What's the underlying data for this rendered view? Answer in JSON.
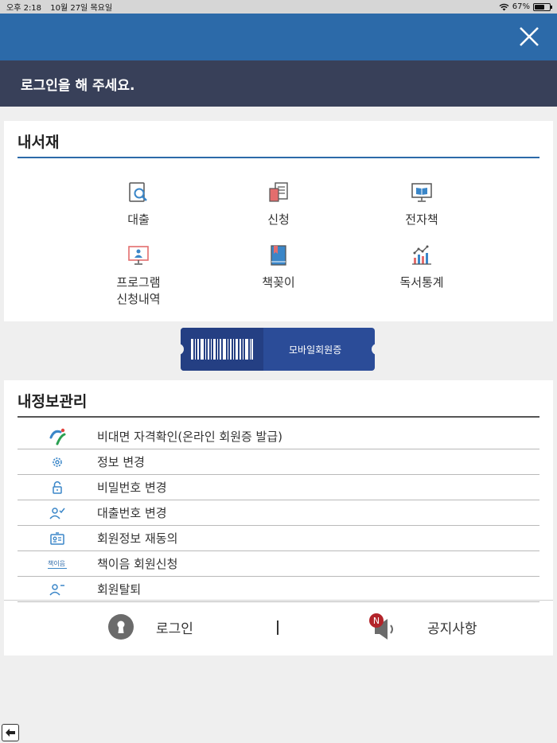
{
  "status_bar": {
    "time": "오후 2:18",
    "date": "10월 27일 목요일",
    "battery": "67%"
  },
  "header": {
    "login_prompt": "로그인을 해 주세요."
  },
  "my_library": {
    "title": "내서재",
    "items": [
      {
        "label": "대출",
        "icon": "book-search-icon"
      },
      {
        "label": "신청",
        "icon": "book-request-icon"
      },
      {
        "label": "전자책",
        "icon": "ebook-monitor-icon"
      },
      {
        "label_line1": "프로그램",
        "label_line2": "신청내역",
        "icon": "program-monitor-icon"
      },
      {
        "label": "책꽂이",
        "icon": "bookshelf-icon"
      },
      {
        "label": "독서통계",
        "icon": "reading-stats-icon"
      }
    ]
  },
  "mobile_card": {
    "label": "모바일회원증"
  },
  "my_info": {
    "title": "내정보관리",
    "items": [
      {
        "label": "비대면 자격확인(온라인 회원증 발급)",
        "icon": "verification-logo-icon"
      },
      {
        "label": "정보 변경",
        "icon": "gear-icon"
      },
      {
        "label": "비밀번호 변경",
        "icon": "unlock-icon"
      },
      {
        "label": "대출번호 변경",
        "icon": "user-check-icon"
      },
      {
        "label": "회원정보 재동의",
        "icon": "id-card-icon"
      },
      {
        "label": "책이음 회원신청",
        "icon": "chaekieum-logo-icon"
      },
      {
        "label": "회원탈퇴",
        "icon": "user-minus-icon"
      }
    ],
    "chaekieum_logo_text": "책이음"
  },
  "footer": {
    "login_label": "로그인",
    "notice_label": "공지사항",
    "notice_badge": "N"
  },
  "colors": {
    "header_blue": "#2c6aa9",
    "banner_navy": "#384059",
    "card_blue": "#2b4c98",
    "icon_blue": "#3a86c8",
    "badge_red": "#b3242a"
  }
}
